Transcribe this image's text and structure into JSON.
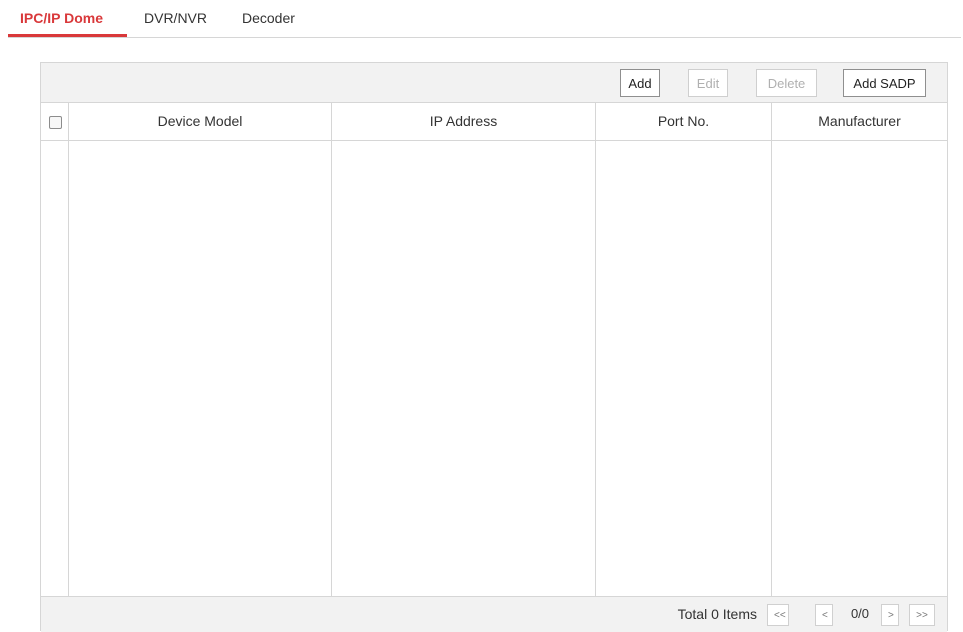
{
  "tabs": [
    {
      "label": "IPC/IP Dome",
      "active": true
    },
    {
      "label": "DVR/NVR",
      "active": false
    },
    {
      "label": "Decoder",
      "active": false
    }
  ],
  "toolbar": {
    "add_label": "Add",
    "edit_label": "Edit",
    "delete_label": "Delete",
    "add_sadp_label": "Add SADP"
  },
  "table": {
    "columns": [
      "Device Model",
      "IP Address",
      "Port No.",
      "Manufacturer"
    ],
    "rows": []
  },
  "pagination": {
    "total_label": "Total 0 Items",
    "first": "<<",
    "prev": "<",
    "page_info": "0/0",
    "next": ">",
    "last": ">>"
  },
  "colors": {
    "accent": "#d9383a",
    "toolbar_bg": "#f2f2f2",
    "border": "#d6d6d6"
  }
}
